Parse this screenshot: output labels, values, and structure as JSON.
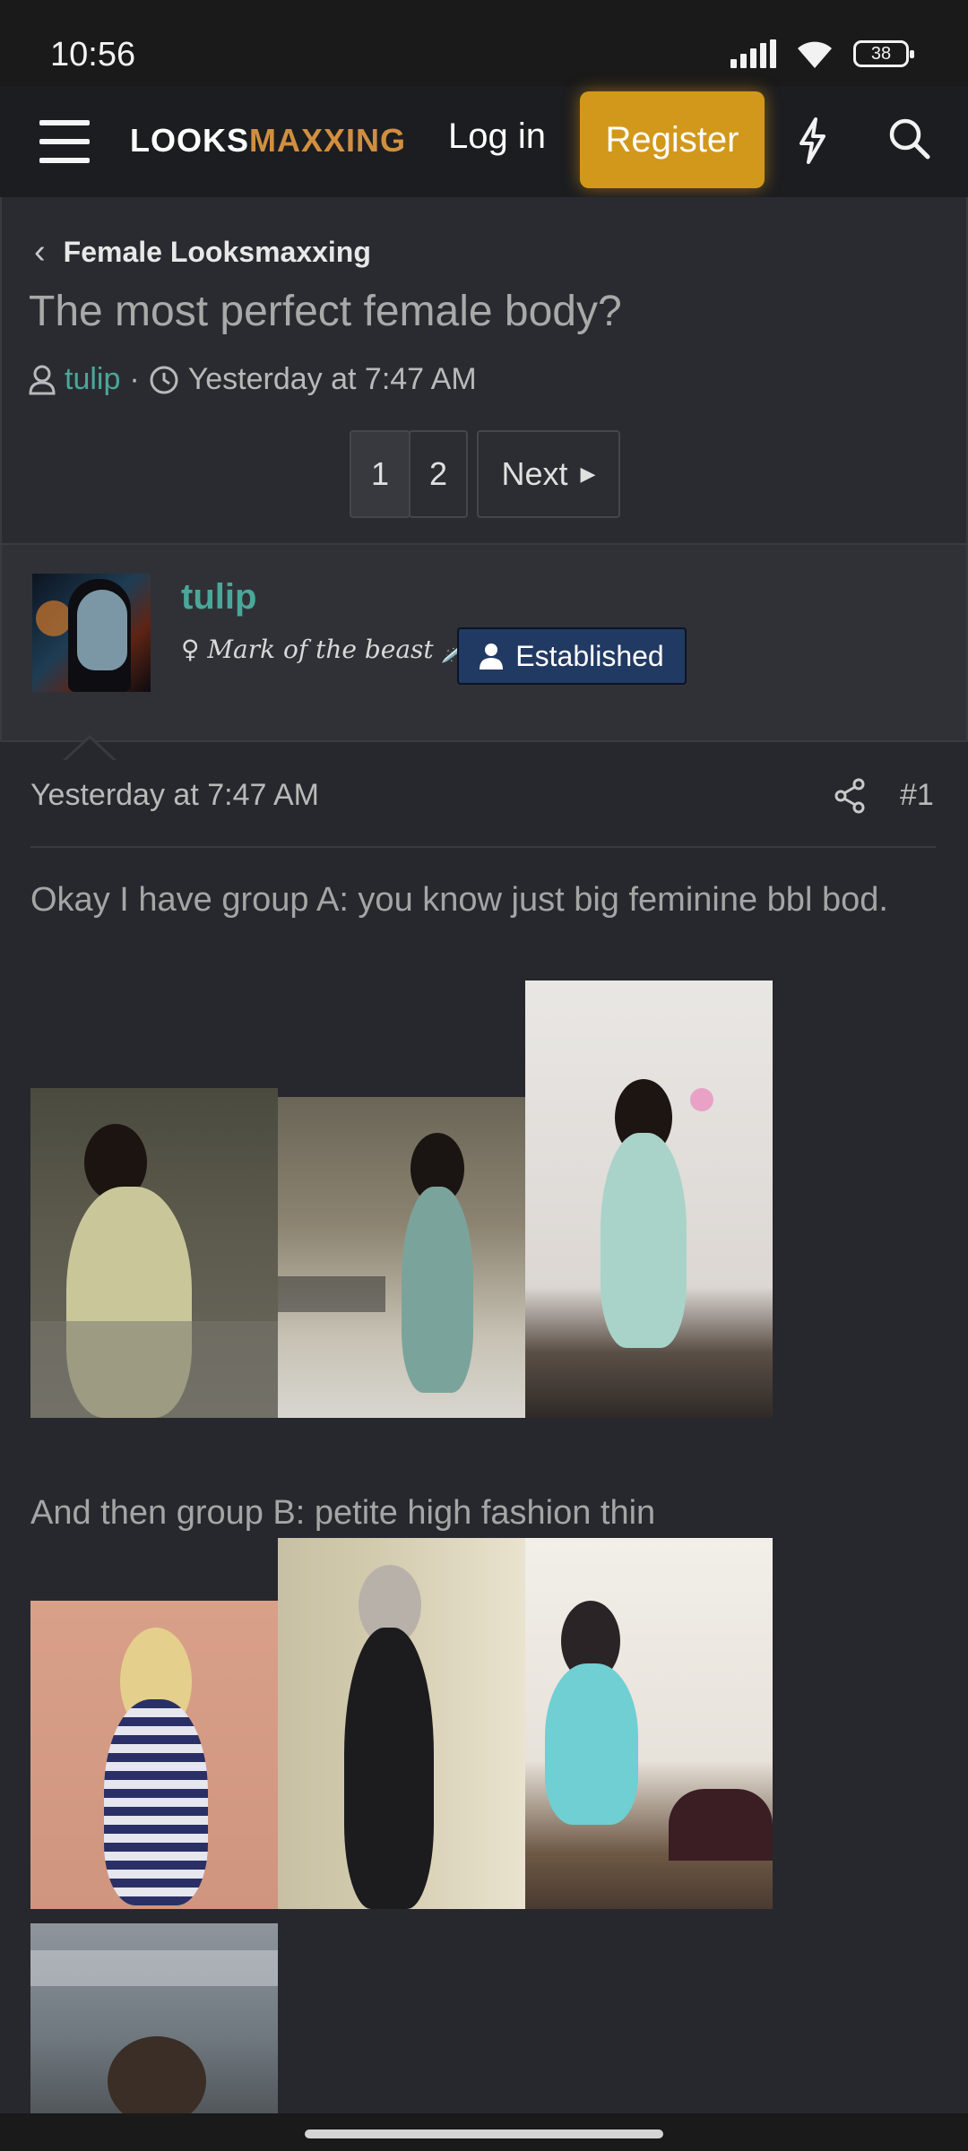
{
  "status_bar": {
    "time": "10:56",
    "battery": "38"
  },
  "header": {
    "logo_part1": "LOOKS",
    "logo_part2": "MAXXING",
    "login_label": "Log in",
    "register_label": "Register",
    "colors": {
      "accent": "#d2981b",
      "logo_accent": "#d08f3f"
    }
  },
  "thread": {
    "breadcrumb": "Female Looksmaxxing",
    "title": "The most perfect female body?",
    "author": "tulip",
    "separator": "·",
    "timestamp": "Yesterday at 7:47 AM",
    "pages": [
      "1",
      "2"
    ],
    "next_label": "Next"
  },
  "post": {
    "username": "tulip",
    "user_title": "♀ Mark of the beast 🗡️",
    "badge": "Established",
    "date": "Yesterday at 7:47 AM",
    "number": "#1",
    "text_a": "Okay I have group A: you know just big feminine bbl bod.",
    "text_b": "And then group B: petite high fashion thin"
  }
}
